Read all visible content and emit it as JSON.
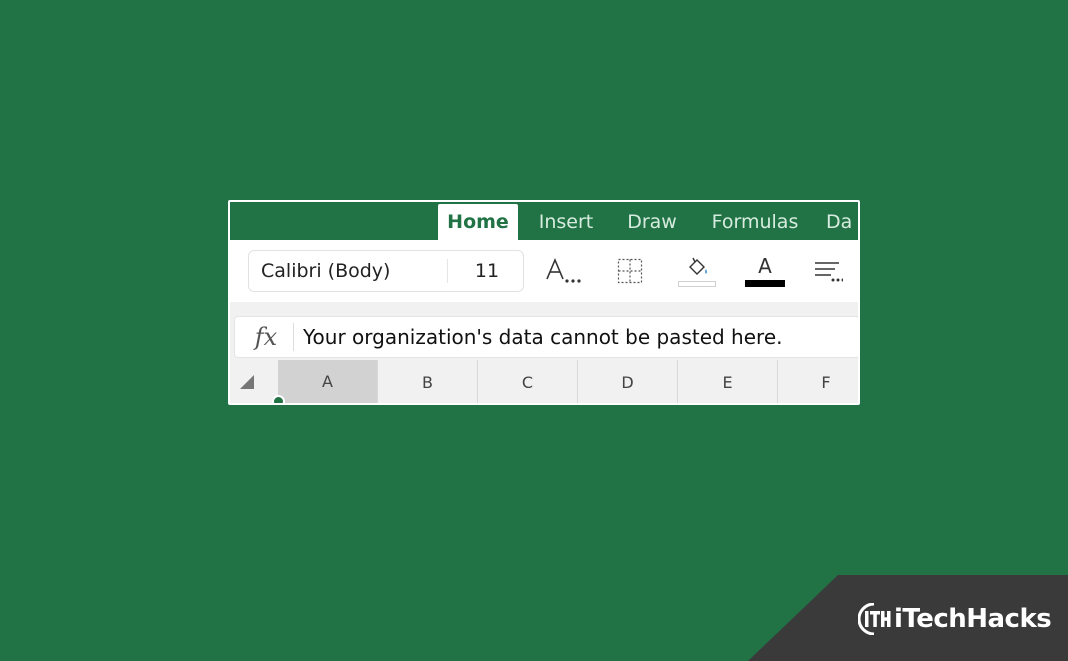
{
  "ribbon": {
    "tabs": [
      {
        "label": "Home",
        "active": true
      },
      {
        "label": "Insert",
        "active": false
      },
      {
        "label": "Draw",
        "active": false
      },
      {
        "label": "Formulas",
        "active": false
      },
      {
        "label": "Da",
        "active": false
      }
    ]
  },
  "toolbar": {
    "font_name": "Calibri (Body)",
    "font_size": "11",
    "font_options_icon": "font-options-icon",
    "borders_icon": "borders-icon",
    "fill_color_icon": "fill-color-icon",
    "font_color_icon": "font-color-icon",
    "font_color_glyph": "A",
    "font_color_value": "#000000",
    "align_icon": "align-more-icon"
  },
  "formula_bar": {
    "fx_label": "fx",
    "content": "Your organization's data cannot be pasted here."
  },
  "columns": {
    "headers": [
      "A",
      "B",
      "C",
      "D",
      "E",
      "F"
    ],
    "selected": "A"
  },
  "watermark": {
    "text": "iTechHacks"
  },
  "colors": {
    "excel_green": "#217346",
    "background": "#217346",
    "watermark_bg": "#3a3a3a"
  }
}
